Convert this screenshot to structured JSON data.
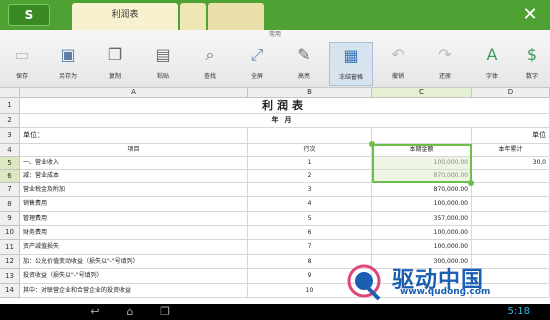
{
  "app": {
    "logo": "S",
    "tab_title": "利润表",
    "close": "✕"
  },
  "toolbar": {
    "caption": "常用",
    "tools": [
      {
        "label": "保存",
        "icon": "save-icon"
      },
      {
        "label": "另存为",
        "icon": "save-as-icon"
      },
      {
        "label": "复制",
        "icon": "copy-icon"
      },
      {
        "label": "粘贴",
        "icon": "paste-icon"
      },
      {
        "label": "查找",
        "icon": "find-icon"
      },
      {
        "label": "全屏",
        "icon": "fullscreen-icon"
      },
      {
        "label": "高亮",
        "icon": "highlight-icon"
      },
      {
        "label": "冻结窗格",
        "icon": "freeze-panes-icon"
      },
      {
        "label": "撤销",
        "icon": "undo-icon"
      },
      {
        "label": "还原",
        "icon": "redo-icon"
      },
      {
        "label": "字体",
        "icon": "font-icon"
      },
      {
        "label": "数字",
        "icon": "number-format-icon"
      }
    ]
  },
  "sheet": {
    "columns": [
      "A",
      "B",
      "C",
      "D"
    ],
    "selected_column": "C",
    "selected_rows": [
      "5",
      "6"
    ],
    "title": "利润表",
    "subtitle": "年月",
    "unit_label": "单位：",
    "unit_label_d": "单位",
    "headers": {
      "item": "项目",
      "row_no": "行次",
      "current": "本期金额",
      "ytd": "本年累计"
    },
    "rows": [
      {
        "num": "5",
        "item": "一、营业收入",
        "row_no": "1",
        "current": "100,000.00",
        "ytd": "30,0"
      },
      {
        "num": "6",
        "item": "减：营业成本",
        "row_no": "2",
        "current": "870,000.00",
        "ytd": ""
      },
      {
        "num": "7",
        "item": "营业税金及附加",
        "row_no": "3",
        "current": "870,000.00",
        "ytd": ""
      },
      {
        "num": "8",
        "item": "销售费用",
        "row_no": "4",
        "current": "100,000.00",
        "ytd": ""
      },
      {
        "num": "9",
        "item": "管理费用",
        "row_no": "5",
        "current": "357,000.00",
        "ytd": ""
      },
      {
        "num": "10",
        "item": "财务费用",
        "row_no": "6",
        "current": "100,000.00",
        "ytd": ""
      },
      {
        "num": "11",
        "item": "资产减值损失",
        "row_no": "7",
        "current": "100,000.00",
        "ytd": ""
      },
      {
        "num": "12",
        "item": "加：公允价值变动收益（损失以\"-\"号填列）",
        "row_no": "8",
        "current": "300,000.00",
        "ytd": ""
      },
      {
        "num": "13",
        "item": "投资收益（损失以\"-\"号填列）",
        "row_no": "9",
        "current": "",
        "ytd": ""
      },
      {
        "num": "14",
        "item": "其中：对联营企业和合营企业的投资收益",
        "row_no": "10",
        "current": "",
        "ytd": ""
      }
    ]
  },
  "watermark": {
    "text": "驱动中国",
    "url": "www.qudong.com"
  },
  "navbar": {
    "back": "back-icon",
    "home": "home-icon",
    "recent": "recent-apps-icon",
    "time": "5:18"
  }
}
